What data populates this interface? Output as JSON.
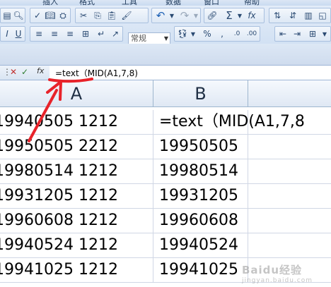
{
  "menu": {
    "items": [
      "插入",
      "格式",
      "工具",
      "数据",
      "窗口",
      "帮助"
    ]
  },
  "toolbar": {
    "number_format": "常规"
  },
  "formula_bar": {
    "content": "=text（MID(A1,7,8)"
  },
  "columns": [
    "A",
    "B"
  ],
  "rows": [
    {
      "a": "19940505 1212",
      "b": "=text（MID(A1,7,8"
    },
    {
      "a": "19950505 2212",
      "b": "19950505"
    },
    {
      "a": "19980514 1212",
      "b": "19980514"
    },
    {
      "a": "19931205 1212",
      "b": "19931205"
    },
    {
      "a": "19960608 1212",
      "b": "19960608"
    },
    {
      "a": "19940524 1212",
      "b": "19940524"
    },
    {
      "a": "19941025 1212",
      "b": "19941025"
    }
  ],
  "watermark": {
    "text": "Baidu经验",
    "sub": "jingyan.baidu.com"
  },
  "colors": {
    "annotation": "#e8232a",
    "ribbon": "#d2e1f3"
  }
}
